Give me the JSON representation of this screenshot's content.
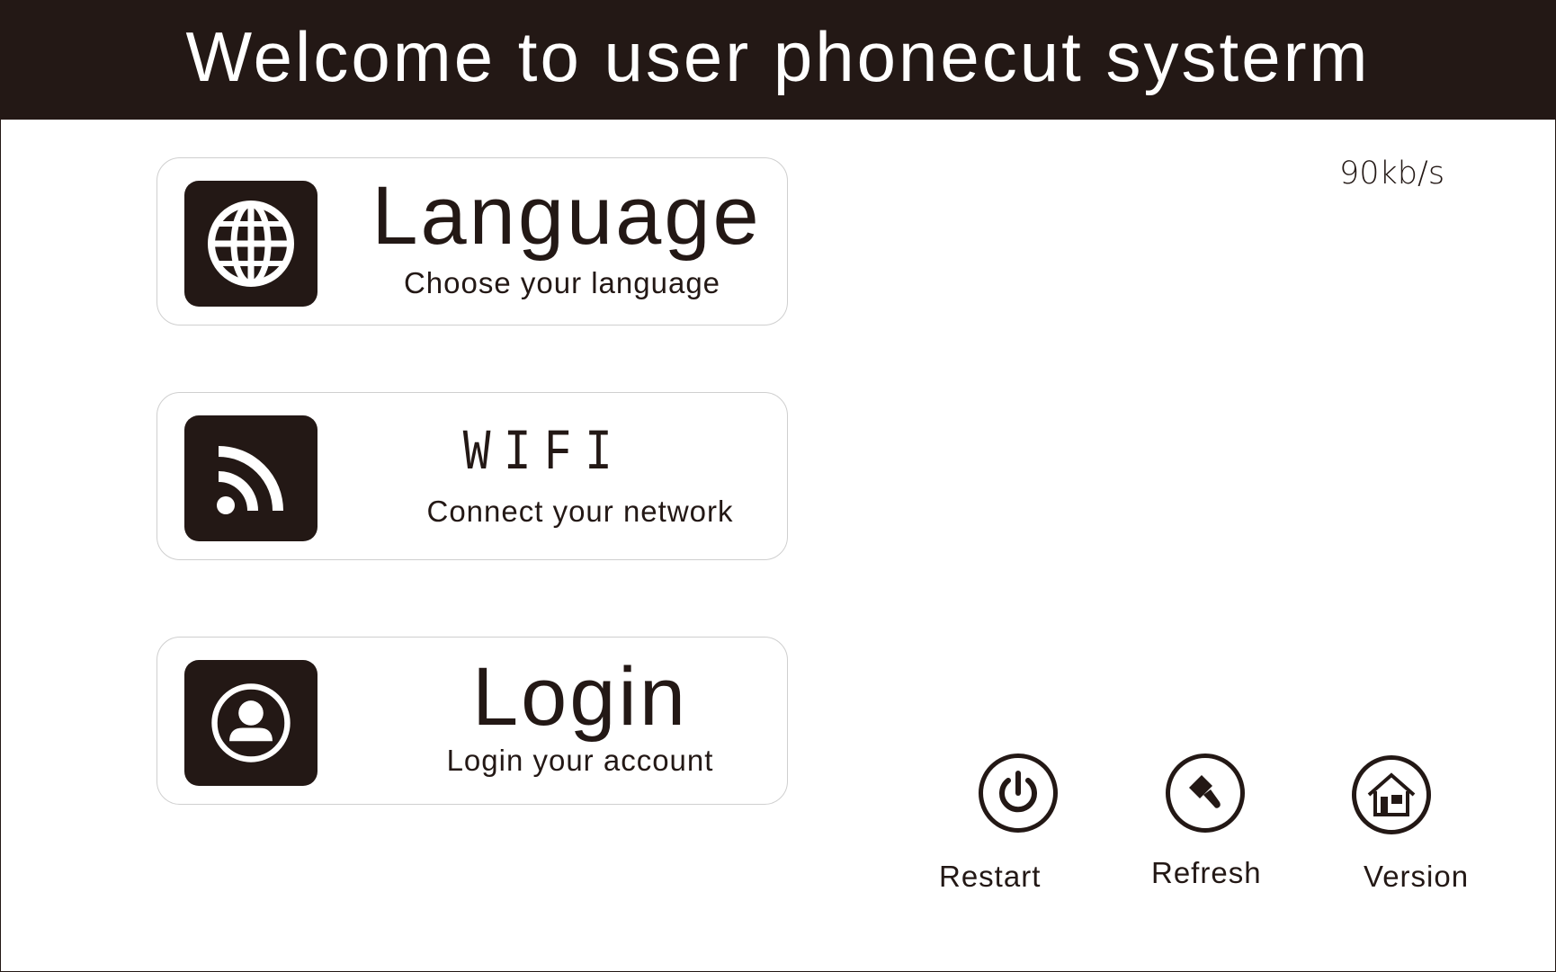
{
  "header": {
    "title": "Welcome to user phonecut systerm"
  },
  "menu": [
    {
      "title": "Language",
      "subtitle": "Choose your language",
      "icon": "globe-icon"
    },
    {
      "title": "WIFI",
      "subtitle": "Connect your network",
      "icon": "wifi-icon"
    },
    {
      "title": "Login",
      "subtitle": "Login your account",
      "icon": "user-icon"
    }
  ],
  "status": {
    "speed": "90kb/s"
  },
  "actions": [
    {
      "label": "Restart",
      "icon": "power-icon"
    },
    {
      "label": "Refresh",
      "icon": "brush-icon"
    },
    {
      "label": "Version",
      "icon": "home-icon"
    }
  ],
  "colors": {
    "dark": "#231815",
    "background": "#ffffff",
    "card_border": "#cfcfcf"
  }
}
